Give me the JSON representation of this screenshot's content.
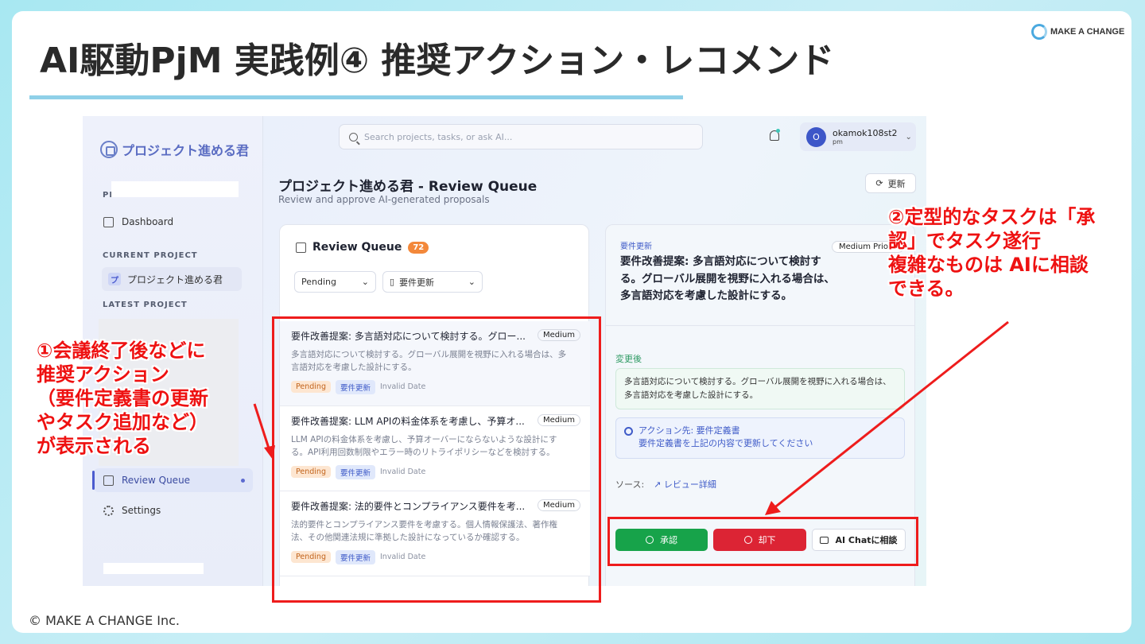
{
  "slide": {
    "title": "AI駆動PjM 実践例④ 推奨アクション・レコメンド",
    "brand": "MAKE A CHANGE",
    "copyright": "© MAKE A CHANGE Inc."
  },
  "app": {
    "logo": "プロジェクト進める君",
    "search_placeholder": "Search projects, tasks, or ask AI...",
    "user": {
      "initial": "O",
      "name": "okamok108st2",
      "role": "pm"
    },
    "sidebar": {
      "section_label": "PL",
      "dashboard": "Dashboard",
      "current_project_label": "CURRENT PROJECT",
      "current_project_badge": "プ",
      "current_project": "プロジェクト進める君",
      "latest_project_label": "LATEST PROJECT",
      "review_queue": "Review Queue",
      "settings": "Settings"
    },
    "page": {
      "title": "プロジェクト進める君 - Review Queue",
      "subtitle": "Review and approve AI-generated proposals",
      "refresh": "更新"
    },
    "queue": {
      "title": "Review Queue",
      "count": "72",
      "filter_status": "Pending",
      "filter_type": "要件更新",
      "items": [
        {
          "title": "要件改善提案: 多言語対応について検討する。グロー...",
          "badge": "Medium",
          "desc": "多言語対応について検討する。グローバル展開を視野に入れる場合は、多言語対応を考慮した設計にする。",
          "status": "Pending",
          "type": "要件更新",
          "date": "Invalid Date"
        },
        {
          "title": "要件改善提案: LLM APIの料金体系を考慮し、予算オ...",
          "badge": "Medium",
          "desc": "LLM APIの料金体系を考慮し、予算オーバーにならないような設計にする。API利用回数制限やエラー時のリトライポリシーなどを検討する。",
          "status": "Pending",
          "type": "要件更新",
          "date": "Invalid Date"
        },
        {
          "title": "要件改善提案: 法的要件とコンプライアンス要件を考...",
          "badge": "Medium",
          "desc": "法的要件とコンプライアンス要件を考慮する。個人情報保護法、著作権法、その他関連法規に準拠した設計になっているか確認する。",
          "status": "Pending",
          "type": "要件更新",
          "date": "Invalid Date"
        }
      ]
    },
    "detail": {
      "type": "要件更新",
      "priority": "Medium Priorit",
      "title": "要件改善提案: 多言語対応について検討する。グローバル展開を視野に入れる場合は、多言語対応を考慮した設計にする。",
      "after_label": "変更後",
      "after_text": "多言語対応について検討する。グローバル展開を視野に入れる場合は、多言語対応を考慮した設計にする。",
      "action_target": "アクション先: 要件定義書",
      "action_desc": "要件定義書を上記の内容で更新してください",
      "source_label": "ソース:",
      "source_link": "レビュー詳細",
      "approve": "承認",
      "reject": "却下",
      "ai_chat": "AI Chatに相談"
    }
  },
  "annotations": {
    "left": "①会議終了後などに\n推奨アクション\n（要件定義書の更新\nやタスク追加など）\nが表示される",
    "right": "②定型的なタスクは「承\n認」でタスク遂行\n複雑なものは AIに相談\nできる。"
  },
  "colors": {
    "annotation": "#ee1c1c",
    "approve": "#17a34a",
    "reject": "#dc2434",
    "accent": "#3f5bc8"
  }
}
